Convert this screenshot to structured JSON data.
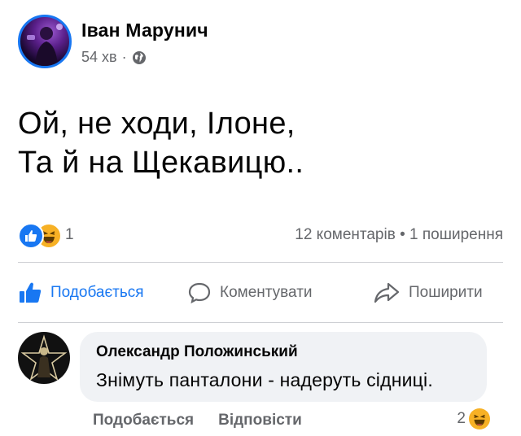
{
  "post": {
    "author": "Іван Марунич",
    "time": "54 хв",
    "separator": "·",
    "privacy_icon": "globe-icon",
    "text_line1": "Ой, не ходи, Ілоне,",
    "text_line2": "Та й на Щекавицю.."
  },
  "reactions": {
    "icons": [
      "like-reaction-icon",
      "haha-reaction-icon"
    ],
    "count": "1",
    "stats": "12 коментарів • 1 поширення"
  },
  "actions": {
    "like": "Подобається",
    "comment": "Коментувати",
    "share": "Поширити"
  },
  "comment": {
    "author": "Олександр Положинський",
    "text": "Знімуть панталони - надеруть сідниці.",
    "like_label": "Подобається",
    "reply_label": "Відповісти",
    "reaction_count": "2"
  },
  "colors": {
    "accent": "#1877f2",
    "secondary_text": "#65676b",
    "bubble": "#f0f2f5",
    "haha": "#f7b125"
  }
}
